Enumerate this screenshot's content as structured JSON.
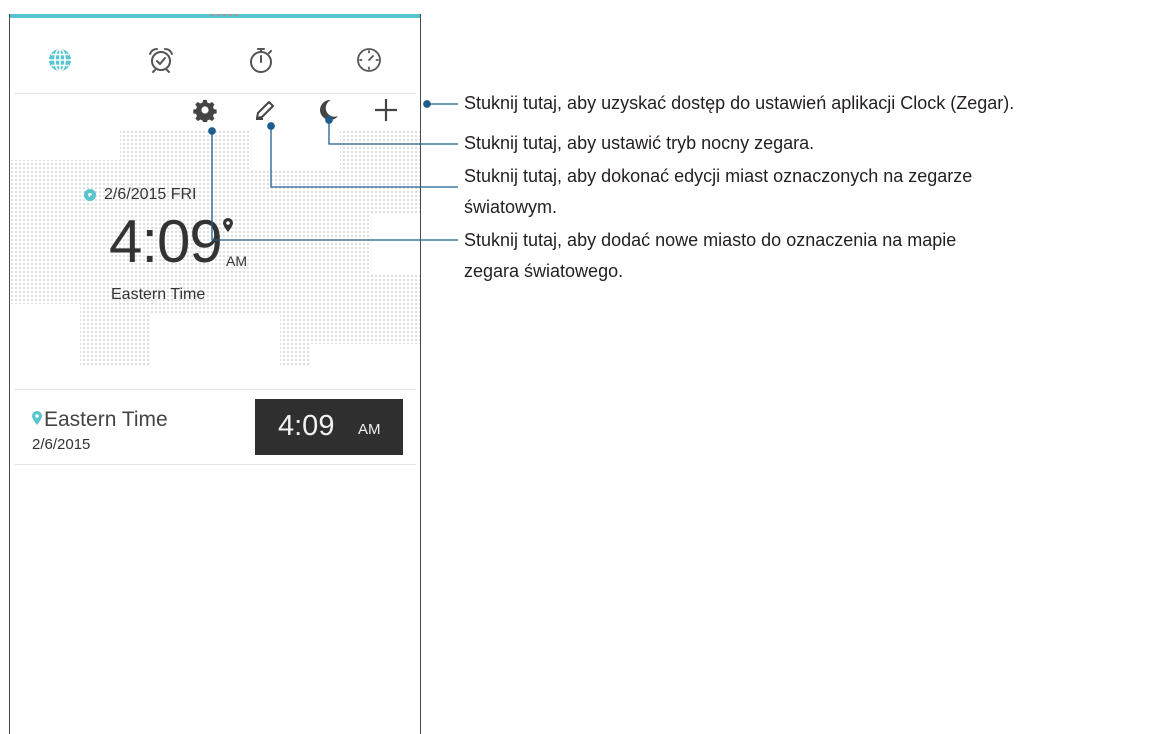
{
  "tabs": [
    {
      "name": "world-clock",
      "icon": "globe-icon",
      "active": true
    },
    {
      "name": "alarm",
      "icon": "alarm-clock-icon",
      "active": false
    },
    {
      "name": "stopwatch",
      "icon": "stopwatch-icon",
      "active": false
    },
    {
      "name": "timer",
      "icon": "timer-icon",
      "active": false
    }
  ],
  "toolbar": {
    "settings_icon": "gear-icon",
    "edit_icon": "pencil-icon",
    "night_mode_icon": "moon-icon",
    "add_icon": "plus-icon"
  },
  "world_clock": {
    "date": "2/6/2015 FRI",
    "time": "4:09",
    "ampm": "AM",
    "timezone": "Eastern Time"
  },
  "cities": [
    {
      "name": "Eastern Time",
      "date": "2/6/2015",
      "time": "4:09",
      "ampm": "AM"
    }
  ],
  "callouts": {
    "settings": "Stuknij tutaj, aby uzyskać dostęp do ustawień aplikacji Clock (Zegar).",
    "night_mode": "Stuknij tutaj, aby ustawić tryb nocny zegara.",
    "edit_line1": "Stuknij tutaj, aby dokonać edycji miast oznaczonych na zegarze",
    "edit_line2": "światowym.",
    "add_line1": "Stuknij tutaj, aby dodać nowe miasto do oznaczenia na mapie",
    "add_line2": "zegara światowego."
  },
  "colors": {
    "accent": "#56c5cf",
    "leader_line": "#1f5d8f",
    "time_box_bg": "#2f2f2f"
  }
}
